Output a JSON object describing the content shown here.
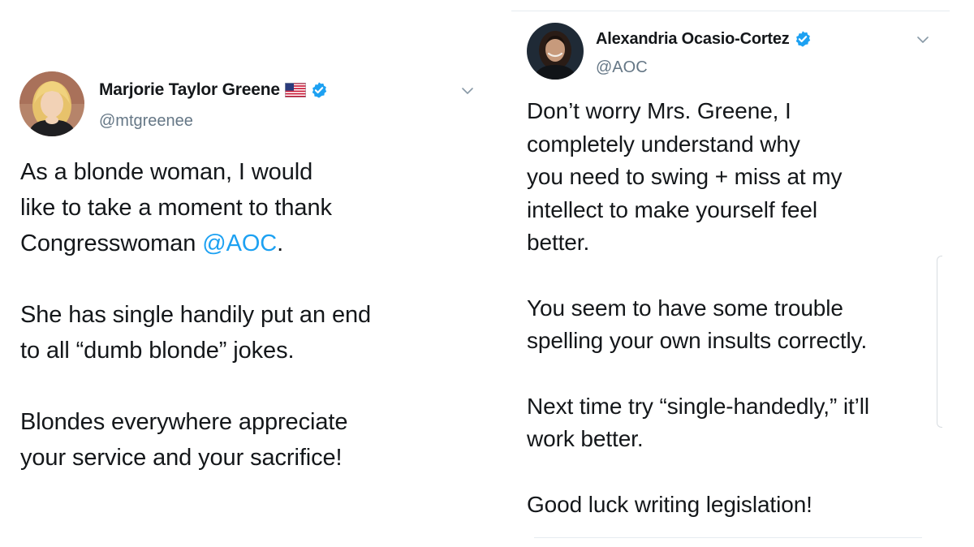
{
  "tweet_left": {
    "display_name": "Marjorie Taylor Greene",
    "handle": "@mtgreenee",
    "avatar_icon": "profile-photo-blonde-woman",
    "flag_icon": "us-flag-icon",
    "verified_icon": "verified-badge-icon",
    "paragraph1_before_mention": "As a blonde woman, I would\nlike to take a moment to thank\nCongresswoman ",
    "paragraph1_mention": "@AOC",
    "paragraph1_after_mention": ".",
    "paragraph2": "She has single handily put an end\nto all “dumb blonde” jokes.",
    "paragraph3": "Blondes everywhere appreciate\nyour service and your sacrifice!"
  },
  "tweet_right": {
    "display_name": "Alexandria Ocasio-Cortez",
    "handle": "@AOC",
    "avatar_icon": "profile-photo-dark-hair-woman",
    "verified_icon": "verified-badge-icon",
    "paragraph1": "Don’t worry Mrs. Greene, I\ncompletely understand why\nyou need to swing + miss at my\nintellect to make yourself feel\nbetter.",
    "paragraph2": "You seem to have some trouble\nspelling your own insults correctly.",
    "paragraph3": "Next time try “single-handedly,” it’ll\nwork better.",
    "paragraph4": "Good luck writing legislation!"
  },
  "colors": {
    "text": "#14171a",
    "secondary_text": "#657786",
    "link": "#1da1f2",
    "verified": "#1da1f2",
    "divider": "#e6ecf0"
  }
}
